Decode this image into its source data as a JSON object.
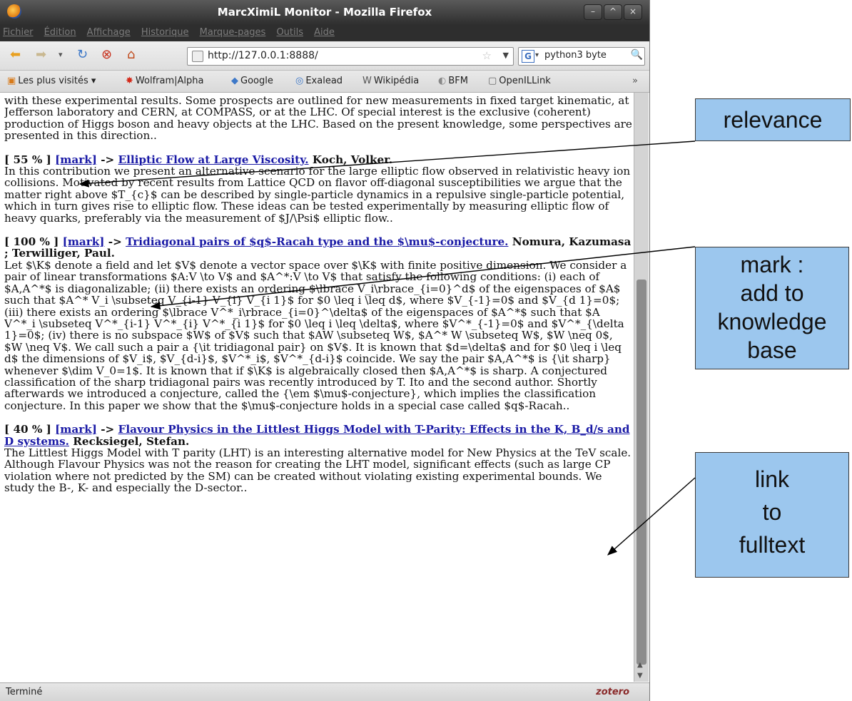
{
  "window": {
    "title": "MarcXimiL Monitor - Mozilla Firefox",
    "controls": [
      "–",
      "^",
      "×"
    ]
  },
  "menu": [
    "Fichier",
    "Édition",
    "Affichage",
    "Historique",
    "Marque-pages",
    "Outils",
    "Aide"
  ],
  "nav": {
    "url": "http://127.0.0.1:8888/",
    "search_engine": "G",
    "search_value": "python3 byte"
  },
  "bookmarks": [
    "Les plus visités ▾",
    "Wolfram|Alpha",
    "Google",
    "Exalead",
    "Wikipédia",
    "BFM",
    "OpenILLink"
  ],
  "content": {
    "intro": "with these experimental results. Some prospects are outlined for new measurements in fixed target kinematic, at Jefferson laboratory and CERN, at COMPASS, or at the LHC. Of special interest is the exclusive (coherent) production of Higgs boson and heavy objects at the LHC. Based on the present knowledge, some perspectives are presented in this direction..",
    "entries": [
      {
        "score": "[ 55 % ]",
        "mark": "[mark]",
        "arrow": "->",
        "title": "Elliptic Flow at Large Viscosity.",
        "authors": "Koch, Volker.",
        "abstract": "In this contribution we present an alternative scenario for the large elliptic flow observed in relativistic heavy ion collisions. Motivated by recent results from Lattice QCD on flavor off-diagonal susceptibilities we argue that the matter right above $T_{c}$ can be described by single-particle dynamics in a repulsive single-particle potential, which in turn gives rise to elliptic flow. These ideas can be tested experimentally by measuring elliptic flow of heavy quarks, preferably via the measurement of $J/\\Psi$ elliptic flow.."
      },
      {
        "score": "[ 100 % ]",
        "mark": "[mark]",
        "arrow": "->",
        "title": "Tridiagonal pairs of $q$-Racah type and the $\\mu$-conjecture.",
        "authors": "Nomura, Kazumasa ; Terwilliger, Paul.",
        "abstract": "Let $\\K$ denote a field and let $V$ denote a vector space over $\\K$ with finite positive dimension. We consider a pair of linear transformations $A:V \\to V$ and $A^*:V \\to V$ that satisfy the following conditions: (i) each of $A,A^*$ is diagonalizable; (ii) there exists an ordering $\\lbrace V_i\\rbrace_{i=0}^d$ of the eigenspaces of $A$ such that $A^* V_i \\subseteq V_{i-1} V_{i} V_{i 1}$ for $0 \\leq i \\leq d$, where $V_{-1}=0$ and $V_{d 1}=0$; (iii) there exists an ordering $\\lbrace V^*_i\\rbrace_{i=0}^\\delta$ of the eigenspaces of $A^*$ such that $A V^*_i \\subseteq V^*_{i-1} V^*_{i} V^*_{i 1}$ for $0 \\leq i \\leq \\delta$, where $V^*_{-1}=0$ and $V^*_{\\delta 1}=0$; (iv) there is no subspace $W$ of $V$ such that $AW \\subseteq W$, $A^* W \\subseteq W$, $W \\neq 0$, $W \\neq V$. We call such a pair a {\\it tridiagonal pair} on $V$. It is known that $d=\\delta$ and for $0 \\leq i \\leq d$ the dimensions of $V_i$, $V_{d-i}$, $V^*_i$, $V^*_{d-i}$ coincide. We say the pair $A,A^*$ is {\\it sharp} whenever $\\dim V_0=1$. It is known that if $\\K$ is algebraically closed then $A,A^*$ is sharp. A conjectured classification of the sharp tridiagonal pairs was recently introduced by T. Ito and the second author. Shortly afterwards we introduced a conjecture, called the {\\em $\\mu$-conjecture}, which implies the classification conjecture. In this paper we show that the $\\mu$-conjecture holds in a special case called $q$-Racah.."
      },
      {
        "score": "[ 40 % ]",
        "mark": "[mark]",
        "arrow": "->",
        "title": "Flavour Physics in the Littlest Higgs Model with T-Parity: Effects in the K, B_d/s and D systems.",
        "authors": "Recksiegel, Stefan.",
        "abstract": "The Littlest Higgs Model with T parity (LHT) is an interesting alternative model for New Physics at the TeV scale. Although Flavour Physics was not the reason for creating the LHT model, significant effects (such as large CP violation where not predicted by the SM) can be created without violating existing experimental bounds. We study the B-, K- and especially the D-sector.."
      }
    ]
  },
  "status": {
    "text": "Terminé",
    "zotero": "zotero"
  },
  "callouts": {
    "relevance": "relevance",
    "mark_l1": "mark :",
    "mark_l2": "add to",
    "mark_l3": "knowledge",
    "mark_l4": "base",
    "link_l1": "link",
    "link_l2": "to",
    "link_l3": "fulltext"
  }
}
